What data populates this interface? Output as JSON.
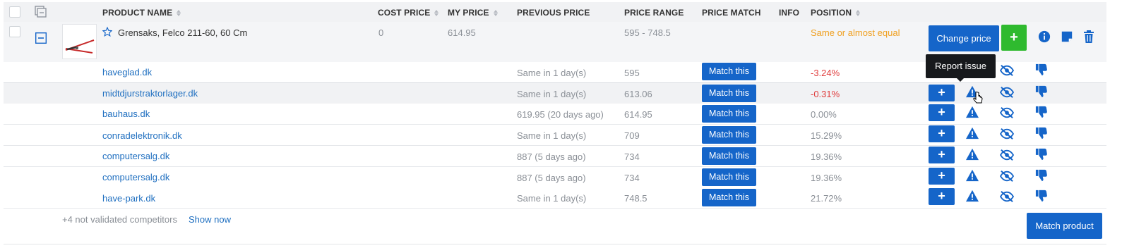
{
  "header": {
    "product_name": "PRODUCT NAME",
    "cost_price": "COST PRICE",
    "my_price": "MY PRICE",
    "previous_price": "PREVIOUS PRICE",
    "price_range": "PRICE RANGE",
    "price_match": "PRICE MATCH",
    "info": "INFO",
    "position": "POSITION"
  },
  "product": {
    "name": "Grensaks, Felco 211-60, 60 Cm",
    "cost_price": "0",
    "my_price": "614.95",
    "price_range": "595 - 748.5",
    "position": "Same or almost equal",
    "change_price_label": "Change price",
    "add_label": "+"
  },
  "competitors": [
    {
      "name": "haveglad.dk",
      "previous": "Same in 1 day(s)",
      "price": "595",
      "match": "Match this",
      "position": "-3.24%"
    },
    {
      "name": "midtdjurstraktorlager.dk",
      "previous": "Same in 1 day(s)",
      "price": "613.06",
      "match": "Match this",
      "position": "-0.31%"
    },
    {
      "name": "bauhaus.dk",
      "previous": "619.95 (20 days ago)",
      "price": "614.95",
      "match": "Match this",
      "position": "0.00%"
    },
    {
      "name": "conradelektronik.dk",
      "previous": "Same in 1 day(s)",
      "price": "709",
      "match": "Match this",
      "position": "15.29%"
    },
    {
      "name": "computersalg.dk",
      "previous": "887 (5 days ago)",
      "price": "734",
      "match": "Match this",
      "position": "19.36%"
    },
    {
      "name": "computersalg.dk",
      "previous": "887 (5 days ago)",
      "price": "734",
      "match": "Match this",
      "position": "19.36%"
    },
    {
      "name": "have-park.dk",
      "previous": "Same in 1 day(s)",
      "price": "748.5",
      "match": "Match this",
      "position": "21.72%"
    }
  ],
  "tooltip": "Report issue",
  "footer": {
    "not_validated": "+4 not validated competitors",
    "show_now": "Show now",
    "match_product": "Match product"
  },
  "colors": {
    "primary": "#1565c9",
    "success": "#2fba2f",
    "negative": "#e03e3e",
    "warning": "#f0a020",
    "link": "#1f6fc0"
  }
}
